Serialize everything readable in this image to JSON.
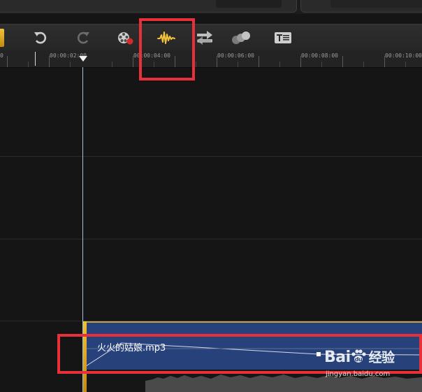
{
  "toolbar": {
    "buttons": [
      {
        "name": "undo",
        "icon": "undo-icon"
      },
      {
        "name": "redo",
        "icon": "redo-icon"
      },
      {
        "name": "record",
        "icon": "film-record-icon"
      },
      {
        "name": "audio-mixing",
        "icon": "audio-waveform-icon"
      },
      {
        "name": "transition",
        "icon": "transition-arrows-icon"
      },
      {
        "name": "effects",
        "icon": "spheres-icon"
      },
      {
        "name": "title",
        "icon": "title-text-icon"
      }
    ],
    "accent_color": "#e8b62c"
  },
  "ruler": {
    "labels": [
      "0",
      "00:00:02:00",
      "00:00:04:00",
      "00:00:06:00",
      "00:00:08:00",
      "00:00:10:00"
    ]
  },
  "audio_clip": {
    "filename": "火火的姑娘.mp3",
    "clip_color": "#27417a"
  },
  "watermark": {
    "brand_latin": "Bai",
    "brand_cn": "经验",
    "url": "jingyan.baidu.com"
  },
  "highlight_color": "#e8303a"
}
